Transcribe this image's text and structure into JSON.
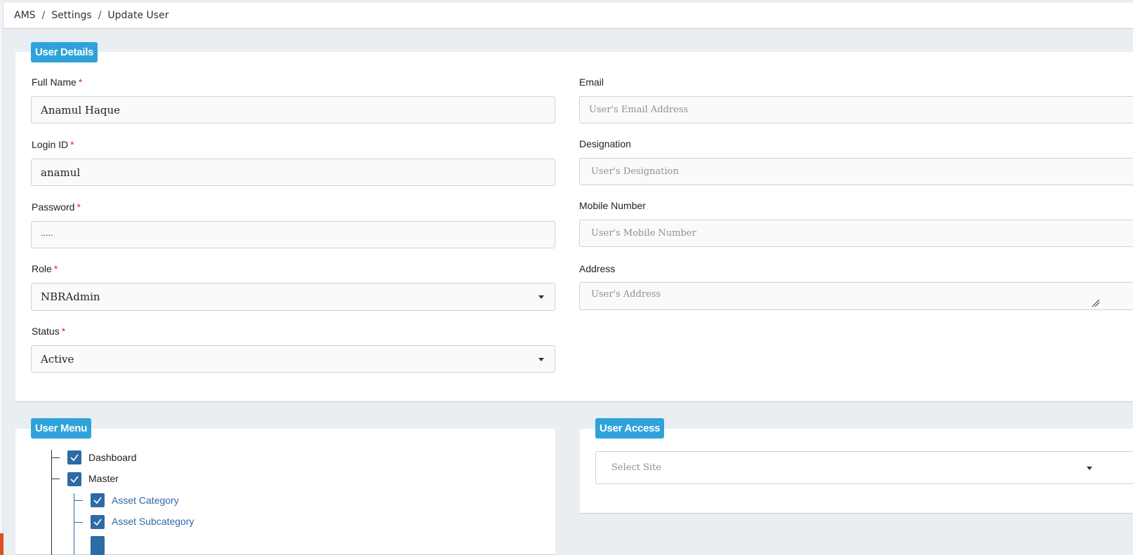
{
  "breadcrumb": {
    "items": [
      "AMS",
      "Settings",
      "Update User"
    ],
    "separator": "/"
  },
  "user_details": {
    "title": "User Details",
    "full_name": {
      "label": "Full Name",
      "required": "*",
      "value": "Anamul Haque"
    },
    "login_id": {
      "label": "Login ID",
      "required": "*",
      "value": "anamul"
    },
    "password": {
      "label": "Password",
      "required": "*",
      "value": "....."
    },
    "role": {
      "label": "Role",
      "required": "*",
      "value": "NBRAdmin"
    },
    "status": {
      "label": "Status",
      "required": "*",
      "value": "Active"
    },
    "email": {
      "label": "Email",
      "placeholder": "User's Email Address"
    },
    "designation": {
      "label": "Designation",
      "placeholder": "User's Designation"
    },
    "mobile": {
      "label": "Mobile Number",
      "placeholder": "User's Mobile Number"
    },
    "address": {
      "label": "Address",
      "placeholder": "User's Address"
    }
  },
  "user_menu": {
    "title": "User Menu",
    "items": [
      {
        "label": "Dashboard",
        "checked": true,
        "level": 0
      },
      {
        "label": "Master",
        "checked": true,
        "level": 0
      },
      {
        "label": "Asset Category",
        "checked": true,
        "level": 1
      },
      {
        "label": "Asset Subcategory",
        "checked": true,
        "level": 1
      }
    ]
  },
  "user_access": {
    "title": "User Access",
    "site_placeholder": "Select Site"
  },
  "colors": {
    "accent": "#2fa3d9",
    "checkbox": "#2d6aa8",
    "required": "#e0282e",
    "page_bg": "#e9eef3"
  }
}
